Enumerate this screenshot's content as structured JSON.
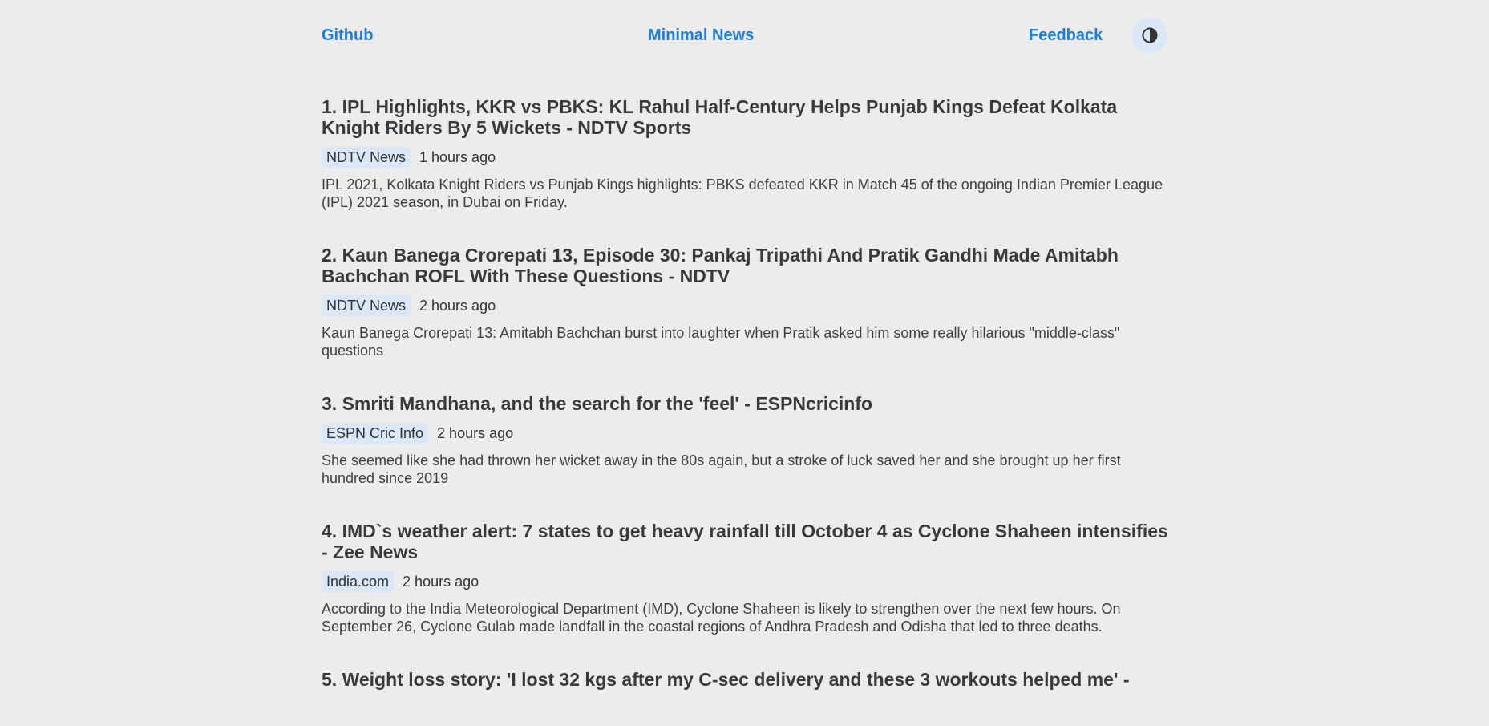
{
  "nav": {
    "github": "Github",
    "title": "Minimal News",
    "feedback": "Feedback",
    "theme_icon": "contrast-icon"
  },
  "articles": [
    {
      "title": "1. IPL Highlights, KKR vs PBKS: KL Rahul Half-Century Helps Punjab Kings Defeat Kolkata Knight Riders By 5 Wickets - NDTV Sports",
      "source": "NDTV News",
      "time": "1 hours ago",
      "summary": "IPL 2021, Kolkata Knight Riders vs Punjab Kings highlights: PBKS defeated KKR in Match 45 of the ongoing Indian Premier League (IPL) 2021 season, in Dubai on Friday."
    },
    {
      "title": "2. Kaun Banega Crorepati 13, Episode 30: Pankaj Tripathi And Pratik Gandhi Made Amitabh Bachchan ROFL With These Questions - NDTV",
      "source": "NDTV News",
      "time": "2 hours ago",
      "summary": "Kaun Banega Crorepati 13: Amitabh Bachchan burst into laughter when Pratik asked him some really hilarious \"middle-class\" questions"
    },
    {
      "title": "3. Smriti Mandhana, and the search for the 'feel' - ESPNcricinfo",
      "source": "ESPN Cric Info",
      "time": "2 hours ago",
      "summary": "She seemed like she had thrown her wicket away in the 80s again, but a stroke of luck saved her and she brought up her first hundred since 2019"
    },
    {
      "title": "4. IMD`s weather alert: 7 states to get heavy rainfall till October 4 as Cyclone Shaheen intensifies - Zee News",
      "source": "India.com",
      "time": "2 hours ago",
      "summary": "According to the India Meteorological Department (IMD), Cyclone Shaheen is likely to strengthen over the next few hours. On September 26, Cyclone Gulab made landfall in the coastal regions of Andhra Pradesh and Odisha that led to three deaths."
    },
    {
      "title": "5. Weight loss story: 'I lost 32 kgs after my C-sec delivery and these 3 workouts helped me' -"
    }
  ],
  "colors": {
    "background": "#ececec",
    "link": "#1a7de0",
    "badge_bg": "#d9e7f6",
    "text": "#333333"
  }
}
